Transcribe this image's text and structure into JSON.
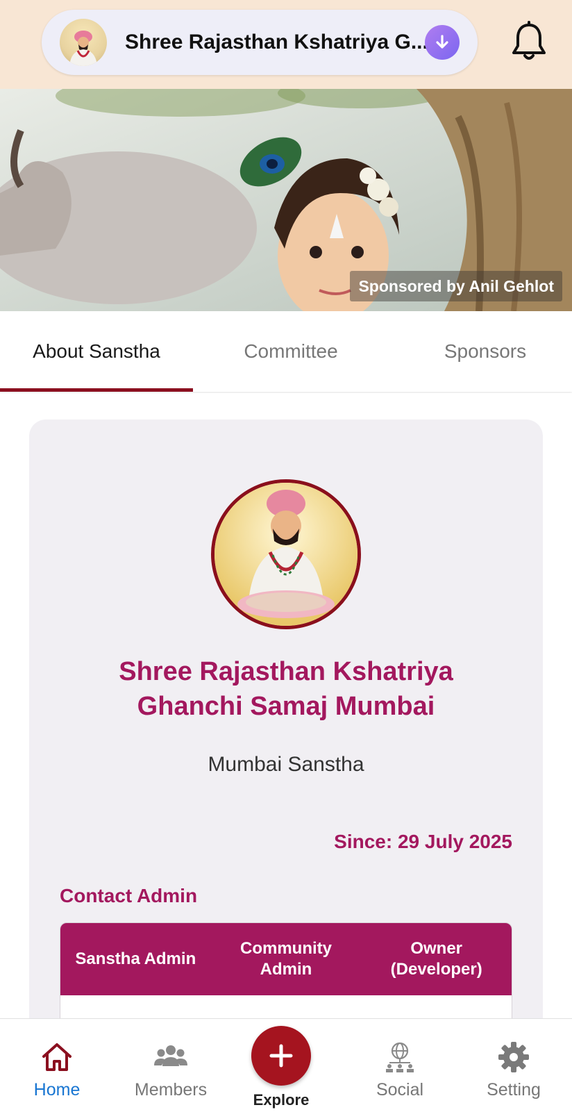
{
  "header": {
    "community_title": "Shree Rajasthan Kshatriya Ghanchi Samaj Mumbai",
    "community_title_display": "Shree Rajasthan Kshatriya G...",
    "avatar_icon": "saint-avatar-icon",
    "download_icon": "download-arrow-icon",
    "notification_icon": "bell-icon"
  },
  "banner": {
    "sponsor_text": "Sponsored by Anil Gehlot"
  },
  "tabs": [
    {
      "label": "About Sanstha",
      "active": true
    },
    {
      "label": "Committee",
      "active": false
    },
    {
      "label": "Sponsors",
      "active": false
    }
  ],
  "about": {
    "name_line1": "Shree Rajasthan Kshatriya",
    "name_line2": "Ghanchi Samaj Mumbai",
    "type": "Mumbai Sanstha",
    "since": "Since: 29 July 2025",
    "contact_title": "Contact Admin",
    "admin_columns": [
      {
        "line1": "Sanstha Admin",
        "line2": ""
      },
      {
        "line1": "Community",
        "line2": "Admin"
      },
      {
        "line1": "Owner",
        "line2": "(Developer)"
      }
    ]
  },
  "bottom_nav": [
    {
      "label": "Home",
      "icon": "home-icon",
      "active": true
    },
    {
      "label": "Members",
      "icon": "members-icon",
      "active": false
    },
    {
      "label": "Explore",
      "icon": "plus-icon",
      "active": false
    },
    {
      "label": "Social",
      "icon": "globe-network-icon",
      "active": false
    },
    {
      "label": "Setting",
      "icon": "gear-icon",
      "active": false
    }
  ],
  "colors": {
    "topbar_bg": "#f8e6d4",
    "accent_maroon": "#8b0f1f",
    "brand_magenta": "#a3185e",
    "active_nav_blue": "#1976d2",
    "explore_red": "#a5141f"
  }
}
